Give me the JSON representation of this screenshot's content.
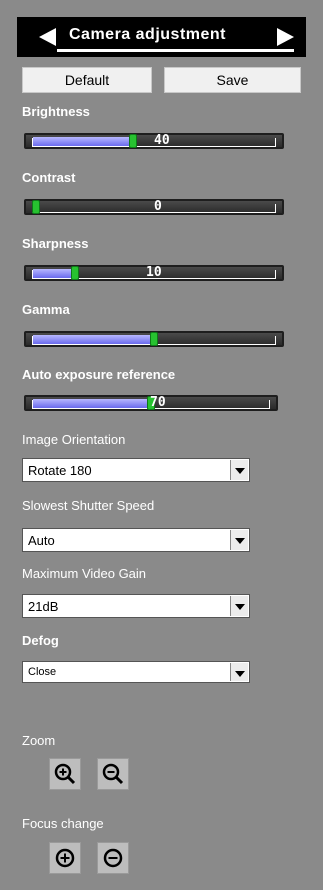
{
  "header": {
    "title": "Camera adjustment"
  },
  "buttons": {
    "default": "Default",
    "save": "Save"
  },
  "sliders": [
    {
      "label": "Brightness",
      "value": "40",
      "level": 0.4
    },
    {
      "label": "Contrast",
      "value": "0",
      "level": 0.0
    },
    {
      "label": "Sharpness",
      "value": "10",
      "level": 0.18
    },
    {
      "label": "Gamma",
      "value": "",
      "level": 0.5
    },
    {
      "label": "Auto exposure reference",
      "value": "70",
      "level": 0.5
    }
  ],
  "selects": [
    {
      "label": "Image Orientation",
      "value": "Rotate 180"
    },
    {
      "label": "Slowest Shutter Speed",
      "value": "Auto"
    },
    {
      "label": "Maximum Video Gain",
      "value": "21dB"
    },
    {
      "label": "Defog",
      "value": "Close"
    }
  ],
  "zoom": {
    "label": "Zoom"
  },
  "focus": {
    "label": "Focus change"
  },
  "colors": {
    "background": "#8a8a8a",
    "thumb": "#27c230",
    "fill": "#7a7aef"
  }
}
